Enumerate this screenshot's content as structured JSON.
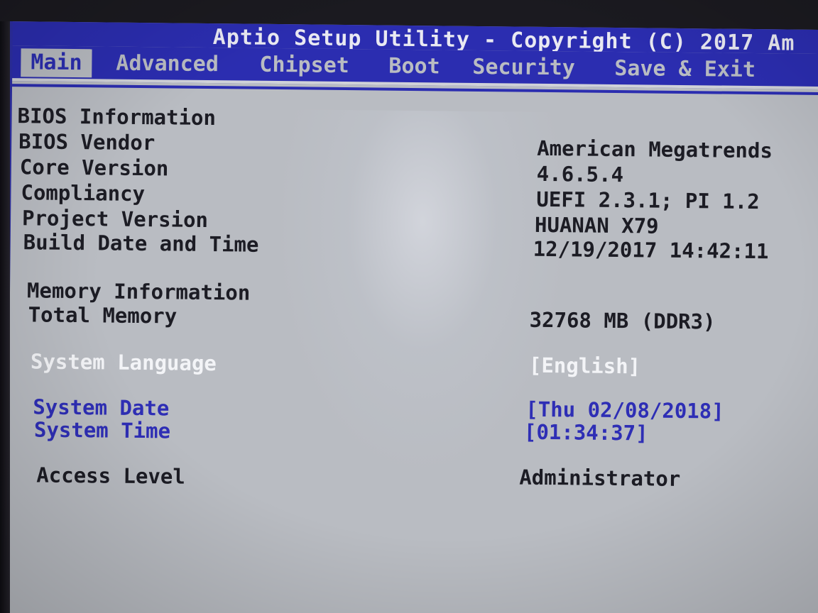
{
  "title": "Aptio Setup Utility - Copyright (C) 2017 Am",
  "tabs": [
    {
      "label": "Main",
      "active": true
    },
    {
      "label": "Advanced",
      "active": false
    },
    {
      "label": "Chipset",
      "active": false
    },
    {
      "label": "Boot",
      "active": false
    },
    {
      "label": "Security",
      "active": false
    },
    {
      "label": "Save & Exit",
      "active": false
    }
  ],
  "bios_info": {
    "heading": "BIOS Information",
    "vendor_label": "BIOS Vendor",
    "vendor_value": "American Megatrends",
    "core_label": "Core Version",
    "core_value": "4.6.5.4",
    "compliancy_label": "Compliancy",
    "compliancy_value": "UEFI 2.3.1; PI 1.2",
    "project_label": "Project Version",
    "project_value": "HUANAN X79",
    "build_label": "Build Date and Time",
    "build_value": "12/19/2017 14:42:11"
  },
  "memory_info": {
    "heading": "Memory Information",
    "total_label": "Total Memory",
    "total_value": "32768 MB (DDR3)"
  },
  "system": {
    "language_label": "System Language",
    "language_value": "[English]",
    "date_label": "System Date",
    "date_value": "[Thu 02/08/2018]",
    "time_label": "System Time",
    "time_value": "[01:34:37]",
    "access_label": "Access Level",
    "access_value": "Administrator"
  },
  "colors": {
    "bar": "#2b2db0",
    "background": "#b9bcc2",
    "selected": "#f3f4f7",
    "editable": "#2e2eb5",
    "text": "#1c1c24"
  }
}
